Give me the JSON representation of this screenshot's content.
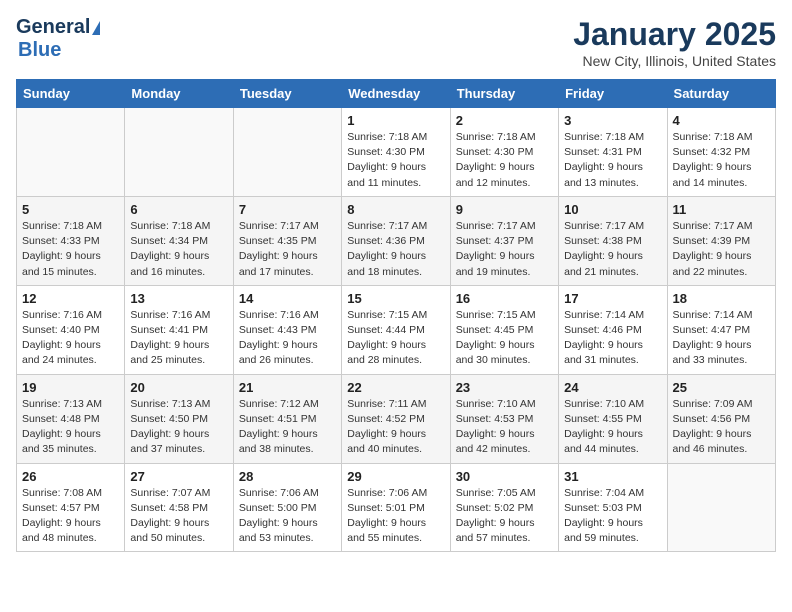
{
  "header": {
    "logo_general": "General",
    "logo_blue": "Blue",
    "month_title": "January 2025",
    "location": "New City, Illinois, United States"
  },
  "days_of_week": [
    "Sunday",
    "Monday",
    "Tuesday",
    "Wednesday",
    "Thursday",
    "Friday",
    "Saturday"
  ],
  "weeks": [
    [
      {
        "day": "",
        "info": ""
      },
      {
        "day": "",
        "info": ""
      },
      {
        "day": "",
        "info": ""
      },
      {
        "day": "1",
        "info": "Sunrise: 7:18 AM\nSunset: 4:30 PM\nDaylight: 9 hours\nand 11 minutes."
      },
      {
        "day": "2",
        "info": "Sunrise: 7:18 AM\nSunset: 4:30 PM\nDaylight: 9 hours\nand 12 minutes."
      },
      {
        "day": "3",
        "info": "Sunrise: 7:18 AM\nSunset: 4:31 PM\nDaylight: 9 hours\nand 13 minutes."
      },
      {
        "day": "4",
        "info": "Sunrise: 7:18 AM\nSunset: 4:32 PM\nDaylight: 9 hours\nand 14 minutes."
      }
    ],
    [
      {
        "day": "5",
        "info": "Sunrise: 7:18 AM\nSunset: 4:33 PM\nDaylight: 9 hours\nand 15 minutes."
      },
      {
        "day": "6",
        "info": "Sunrise: 7:18 AM\nSunset: 4:34 PM\nDaylight: 9 hours\nand 16 minutes."
      },
      {
        "day": "7",
        "info": "Sunrise: 7:17 AM\nSunset: 4:35 PM\nDaylight: 9 hours\nand 17 minutes."
      },
      {
        "day": "8",
        "info": "Sunrise: 7:17 AM\nSunset: 4:36 PM\nDaylight: 9 hours\nand 18 minutes."
      },
      {
        "day": "9",
        "info": "Sunrise: 7:17 AM\nSunset: 4:37 PM\nDaylight: 9 hours\nand 19 minutes."
      },
      {
        "day": "10",
        "info": "Sunrise: 7:17 AM\nSunset: 4:38 PM\nDaylight: 9 hours\nand 21 minutes."
      },
      {
        "day": "11",
        "info": "Sunrise: 7:17 AM\nSunset: 4:39 PM\nDaylight: 9 hours\nand 22 minutes."
      }
    ],
    [
      {
        "day": "12",
        "info": "Sunrise: 7:16 AM\nSunset: 4:40 PM\nDaylight: 9 hours\nand 24 minutes."
      },
      {
        "day": "13",
        "info": "Sunrise: 7:16 AM\nSunset: 4:41 PM\nDaylight: 9 hours\nand 25 minutes."
      },
      {
        "day": "14",
        "info": "Sunrise: 7:16 AM\nSunset: 4:43 PM\nDaylight: 9 hours\nand 26 minutes."
      },
      {
        "day": "15",
        "info": "Sunrise: 7:15 AM\nSunset: 4:44 PM\nDaylight: 9 hours\nand 28 minutes."
      },
      {
        "day": "16",
        "info": "Sunrise: 7:15 AM\nSunset: 4:45 PM\nDaylight: 9 hours\nand 30 minutes."
      },
      {
        "day": "17",
        "info": "Sunrise: 7:14 AM\nSunset: 4:46 PM\nDaylight: 9 hours\nand 31 minutes."
      },
      {
        "day": "18",
        "info": "Sunrise: 7:14 AM\nSunset: 4:47 PM\nDaylight: 9 hours\nand 33 minutes."
      }
    ],
    [
      {
        "day": "19",
        "info": "Sunrise: 7:13 AM\nSunset: 4:48 PM\nDaylight: 9 hours\nand 35 minutes."
      },
      {
        "day": "20",
        "info": "Sunrise: 7:13 AM\nSunset: 4:50 PM\nDaylight: 9 hours\nand 37 minutes."
      },
      {
        "day": "21",
        "info": "Sunrise: 7:12 AM\nSunset: 4:51 PM\nDaylight: 9 hours\nand 38 minutes."
      },
      {
        "day": "22",
        "info": "Sunrise: 7:11 AM\nSunset: 4:52 PM\nDaylight: 9 hours\nand 40 minutes."
      },
      {
        "day": "23",
        "info": "Sunrise: 7:10 AM\nSunset: 4:53 PM\nDaylight: 9 hours\nand 42 minutes."
      },
      {
        "day": "24",
        "info": "Sunrise: 7:10 AM\nSunset: 4:55 PM\nDaylight: 9 hours\nand 44 minutes."
      },
      {
        "day": "25",
        "info": "Sunrise: 7:09 AM\nSunset: 4:56 PM\nDaylight: 9 hours\nand 46 minutes."
      }
    ],
    [
      {
        "day": "26",
        "info": "Sunrise: 7:08 AM\nSunset: 4:57 PM\nDaylight: 9 hours\nand 48 minutes."
      },
      {
        "day": "27",
        "info": "Sunrise: 7:07 AM\nSunset: 4:58 PM\nDaylight: 9 hours\nand 50 minutes."
      },
      {
        "day": "28",
        "info": "Sunrise: 7:06 AM\nSunset: 5:00 PM\nDaylight: 9 hours\nand 53 minutes."
      },
      {
        "day": "29",
        "info": "Sunrise: 7:06 AM\nSunset: 5:01 PM\nDaylight: 9 hours\nand 55 minutes."
      },
      {
        "day": "30",
        "info": "Sunrise: 7:05 AM\nSunset: 5:02 PM\nDaylight: 9 hours\nand 57 minutes."
      },
      {
        "day": "31",
        "info": "Sunrise: 7:04 AM\nSunset: 5:03 PM\nDaylight: 9 hours\nand 59 minutes."
      },
      {
        "day": "",
        "info": ""
      }
    ]
  ]
}
